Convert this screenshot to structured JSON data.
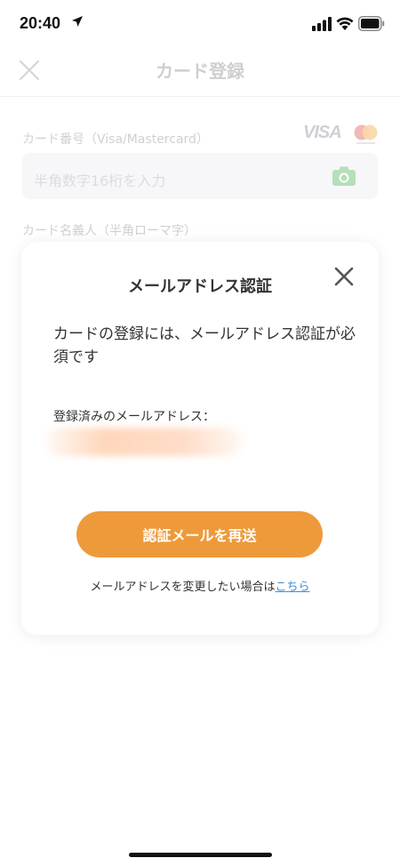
{
  "status_bar": {
    "time": "20:40",
    "icons": [
      "location-arrow-icon",
      "signal-icon",
      "wifi-icon",
      "battery-icon"
    ]
  },
  "background_screen": {
    "title": "カード登録",
    "close_icon": "close-icon",
    "card_number_label": "カード番号（Visa/Mastercard）",
    "brand_visa": "VISA",
    "brand_mastercard_icon": "mastercard-logo",
    "card_number_placeholder": "半角数字16桁を入力",
    "camera_icon": "camera-icon",
    "card_holder_label": "カード名義人（半角ローマ字）"
  },
  "modal": {
    "title": "メールアドレス認証",
    "close_icon": "close-icon",
    "message": "カードの登録には、メールアドレス認証が必須です",
    "registered_email_label": "登録済みのメールアドレス：",
    "resend_button": "認証メールを再送",
    "change_note_prefix": "メールアドレスを変更したい場合は",
    "change_link": "こちら"
  },
  "colors": {
    "accent_orange": "#ef9a3a",
    "link_blue": "#3a8fd6",
    "camera_green": "#b5dfb8"
  }
}
